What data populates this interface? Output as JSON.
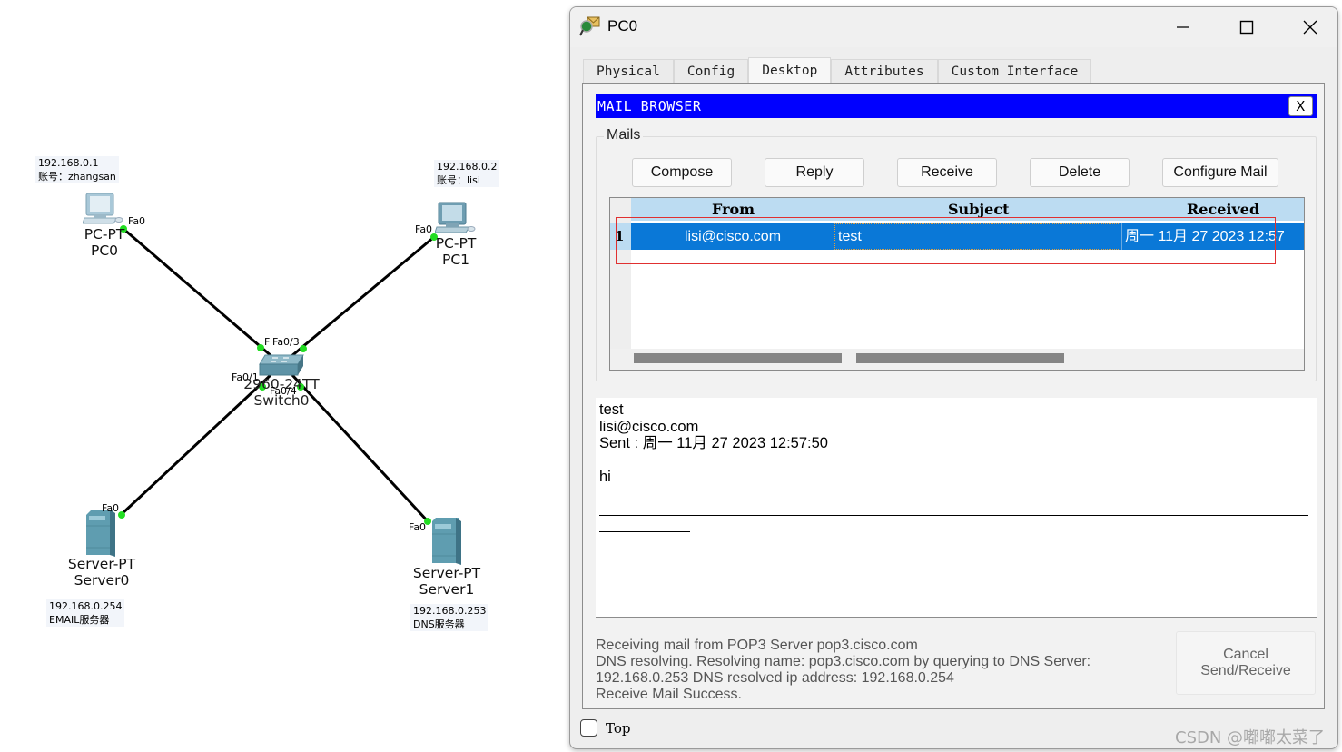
{
  "topology": {
    "devices": [
      {
        "id": "pc0",
        "model": "PC-PT",
        "name": "PC0",
        "port": "Fa0",
        "note_ip": "192.168.0.1",
        "note_extra": "账号：zhangsan"
      },
      {
        "id": "pc1",
        "model": "PC-PT",
        "name": "PC1",
        "port": "Fa0",
        "note_ip": "192.168.0.2",
        "note_extra": "账号：lisi"
      },
      {
        "id": "switch0",
        "model": "2960-24TT",
        "name": "Switch0",
        "ports": [
          "F",
          "Fa0/3",
          "Fa0/1",
          "Fa0/4"
        ]
      },
      {
        "id": "server0",
        "model": "Server-PT",
        "name": "Server0",
        "port": "Fa0",
        "note_ip": "192.168.0.254",
        "note_extra": "EMAIL服务器"
      },
      {
        "id": "server1",
        "model": "Server-PT",
        "name": "Server1",
        "port": "Fa0",
        "note_ip": "192.168.0.253",
        "note_extra": "DNS服务器"
      }
    ],
    "link_status_color": "#22dd22"
  },
  "window": {
    "title": "PC0",
    "controls": {
      "minimize": "minimize-icon",
      "maximize": "maximize-icon",
      "close": "close-icon"
    },
    "tabs": [
      {
        "label": "Physical",
        "active": false
      },
      {
        "label": "Config",
        "active": false
      },
      {
        "label": "Desktop",
        "active": true
      },
      {
        "label": "Attributes",
        "active": false
      },
      {
        "label": "Custom Interface",
        "active": false
      }
    ],
    "top_checkbox": {
      "label": "Top",
      "checked": false
    }
  },
  "mail_browser": {
    "header": "MAIL BROWSER",
    "close_label": "X",
    "header_color": "#0000ff",
    "group_label": "Mails",
    "buttons": {
      "compose": "Compose",
      "reply": "Reply",
      "receive": "Receive",
      "delete": "Delete",
      "configure": "Configure Mail"
    },
    "table": {
      "columns": [
        "From",
        "Subject",
        "Received"
      ],
      "rows": [
        {
          "num": "1",
          "from": "lisi@cisco.com",
          "subject": "test",
          "received": "周一 11月 27 2023 12:57",
          "selected": true
        }
      ],
      "selection_color": "#0a78d7",
      "header_color": "#bcdcf2"
    },
    "message": {
      "subject": "test",
      "from": "lisi@cisco.com",
      "sent": "Sent : 周一 11月 27 2023 12:57:50",
      "blank": "",
      "body": "hi"
    },
    "status": [
      "Receiving mail from POP3 Server pop3.cisco.com",
      "DNS resolving. Resolving name: pop3.cisco.com by querying to DNS Server:",
      "192.168.0.253  DNS resolved ip address: 192.168.0.254",
      "Receive Mail Success."
    ],
    "cancel_button": [
      "Cancel",
      "Send/Receive"
    ]
  },
  "annotation": {
    "highlight_color": "#e03030"
  },
  "watermark": "CSDN @嘟嘟太菜了"
}
